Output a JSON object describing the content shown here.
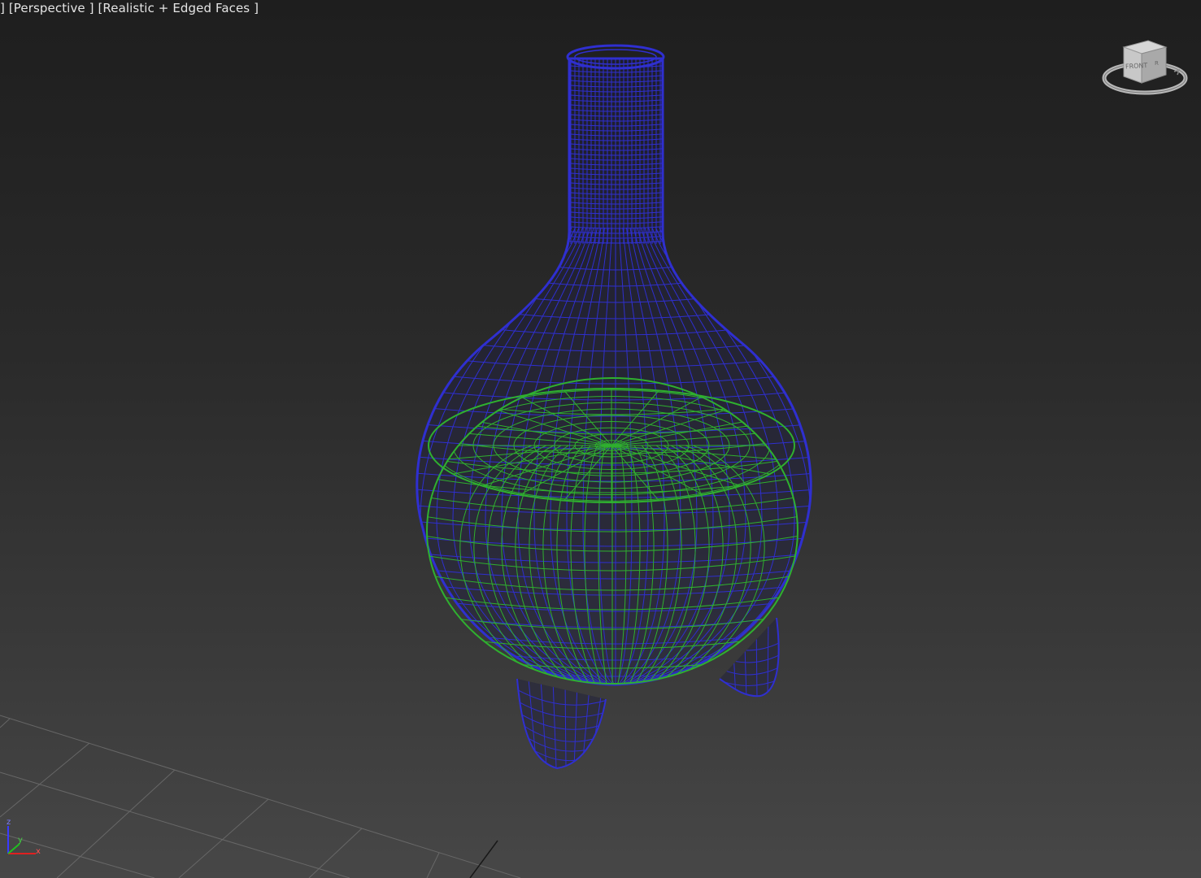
{
  "viewport": {
    "label_prefix": "]",
    "view_menu": "[Perspective ]",
    "shading_menu": "[Realistic + Edged Faces ]"
  },
  "viewcube": {
    "face_label": "FRONT",
    "side_label": "R",
    "icon": "viewcube-icon"
  },
  "axis_tripod": {
    "z": "z",
    "y": "y",
    "x": "x"
  },
  "colors": {
    "flask_wireframe": "#2f2fd0",
    "liquid_wireframe": "#2fb02f",
    "grid": "#6e6e6e",
    "label_text": "#e4e4e4"
  }
}
